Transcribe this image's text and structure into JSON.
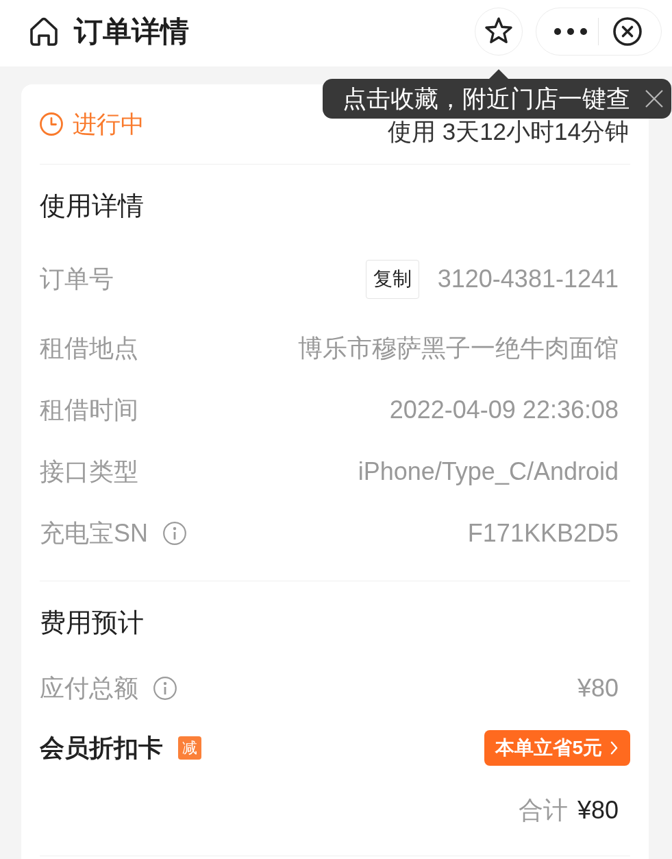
{
  "header": {
    "title": "订单详情"
  },
  "tooltip": {
    "text": "点击收藏，附近门店一键查"
  },
  "status": {
    "label": "进行中",
    "duration": "使用 3天12小时14分钟"
  },
  "sections": [
    {
      "title": "使用详情",
      "rows": [
        {
          "kind": "copy",
          "label": "订单号",
          "action": "复制",
          "value": "3120-4381-1241"
        },
        {
          "kind": "plain",
          "label": "租借地点",
          "value": "博乐市穆萨黑子一绝牛肉面馆"
        },
        {
          "kind": "plain",
          "label": "租借时间",
          "value": "2022-04-09 22:36:08"
        },
        {
          "kind": "plain",
          "label": "接口类型",
          "value": "iPhone/Type_C/Android"
        },
        {
          "kind": "info",
          "label": "充电宝SN",
          "value": "F171KKB2D5"
        }
      ]
    },
    {
      "title": "费用预计",
      "rows": [
        {
          "kind": "info",
          "label": "应付总额",
          "value": "¥80"
        },
        {
          "kind": "discount",
          "label": "会员折扣卡",
          "badge": "减",
          "button": "本单立省5元"
        },
        {
          "kind": "total",
          "label": "合计",
          "value": "¥80"
        }
      ]
    }
  ]
}
